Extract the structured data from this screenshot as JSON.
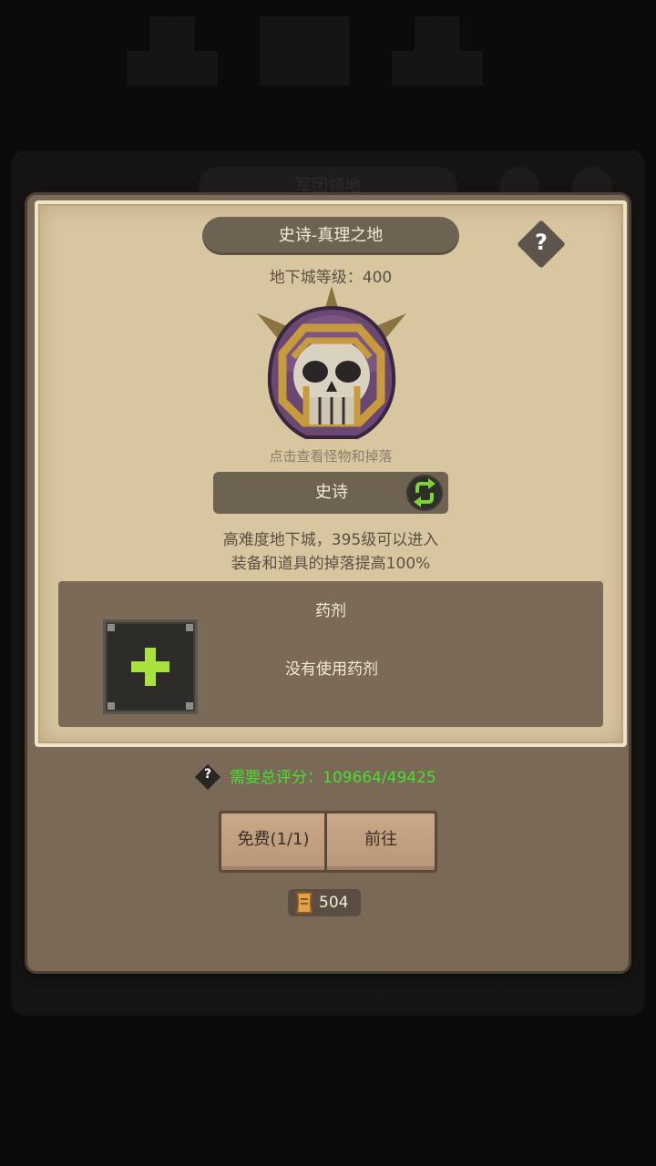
{
  "background": {
    "title": "军团领地"
  },
  "dialog": {
    "title": "史诗-真理之地",
    "level_text": "地下城等级：400",
    "hint": "点击查看怪物和掉落",
    "difficulty": "史诗",
    "description_line1": "高难度地下城，395级可以进入",
    "description_line2": "装备和道具的掉落提高100%",
    "help_glyph": "?"
  },
  "potion": {
    "title": "药剂",
    "empty_text": "没有使用药剂",
    "add_glyph": "+"
  },
  "requirement": {
    "text": "需要总评分：109664/49425",
    "color": "#46e02c",
    "help_glyph": "?"
  },
  "buttons": {
    "free": "免费(1/1)",
    "go": "前往"
  },
  "currency": {
    "icon": "scroll-ticket-icon",
    "amount": "504"
  },
  "colors": {
    "parchment": "#d8c6a1",
    "panel": "#7a6957",
    "banner": "#6e6252",
    "accent_green": "#7fd13a"
  }
}
